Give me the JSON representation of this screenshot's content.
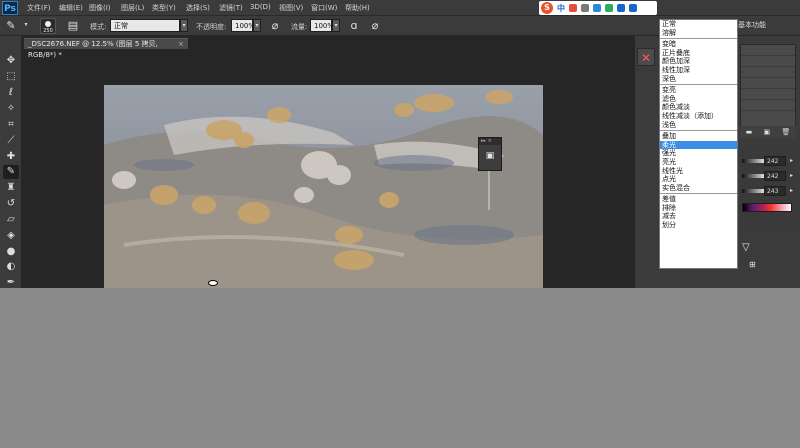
{
  "app": {
    "logo": "Ps"
  },
  "menu": [
    "文件(F)",
    "编辑(E)",
    "图像(I)",
    "图层(L)",
    "类型(Y)",
    "选择(S)",
    "滤镜(T)",
    "3D(D)",
    "视图(V)",
    "窗口(W)",
    "帮助(H)"
  ],
  "ime": {
    "logo": "S",
    "label": "中"
  },
  "options": {
    "brush_size": "250",
    "mode_label": "模式:",
    "mode_value": "正常",
    "opacity_label": "不透明度:",
    "opacity_value": "100%",
    "flow_label": "流量:",
    "flow_value": "100%"
  },
  "workspace": "基本功能",
  "document": {
    "tab_title": "_DSC2676.NEF @ 12.5% (图层 5 拷贝, RGB/8*) *",
    "close": "×"
  },
  "blend_modes": [
    [
      "正常",
      "溶解"
    ],
    [
      "变暗",
      "正片叠底",
      "颜色加深",
      "线性加深",
      "深色"
    ],
    [
      "变亮",
      "滤色",
      "颜色减淡",
      "线性减淡（添加）",
      "浅色"
    ],
    [
      "叠加",
      "柔光",
      "强光",
      "亮光",
      "线性光",
      "点光",
      "实色混合"
    ],
    [
      "差值",
      "排除",
      "减去",
      "划分"
    ]
  ],
  "blend_selected": "柔光",
  "color": {
    "r": "242",
    "g": "242",
    "b": "243"
  },
  "colors": {
    "accent": "#3a8ee6",
    "dock_close": "#ff5a5a",
    "chrome": "#3b3b3b",
    "workspace_bg": "#8a8a8a"
  }
}
